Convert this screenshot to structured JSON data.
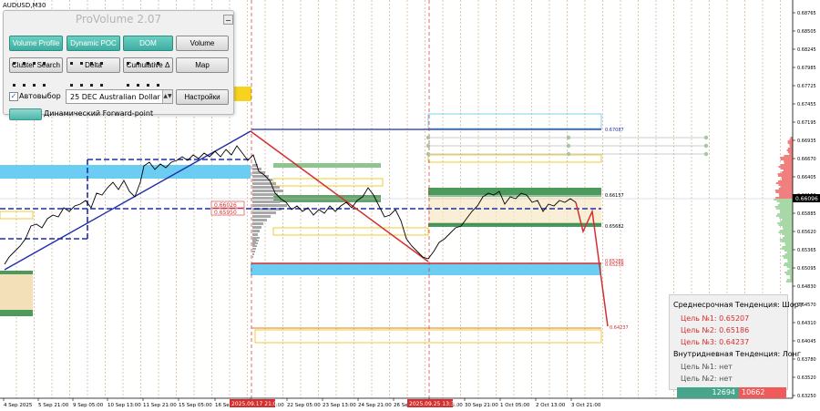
{
  "chart": {
    "symbol": "AUDUSD,M30",
    "current_price": "0.66096",
    "y_ticks": [
      "0.68765",
      "0.68505",
      "0.68245",
      "0.67985",
      "0.67725",
      "0.67455",
      "0.67195",
      "0.66935",
      "0.66670",
      "0.66405",
      "0.66150",
      "0.65885",
      "0.65620",
      "0.65365",
      "0.65095",
      "0.64830",
      "0.64570",
      "0.64310",
      "0.64045",
      "0.63780",
      "0.63520",
      "0.63250"
    ],
    "x_ticks": [
      "4 Sep 2025",
      "5 Sep 21:00",
      "9 Sep 05:00",
      "10 Sep 13:00",
      "11 Sep 21:00",
      "15 Sep 05:00",
      "16 Sep 13:00",
      "17 Sep 21:00",
      "22 Sep 05:00",
      "23 Sep 13:00",
      "24 Sep 21:00",
      "26 Sep 05:00",
      "29 Sep 13:00",
      "30 Sep 21:00",
      "1 Oct 05:00",
      "2 Oct 13:00",
      "3 Oct 21:00"
    ],
    "x_highlight_1": "2025.09.17 21:00",
    "x_highlight_2": "2025.09.25 13:30",
    "levels": {
      "l1": "0.67087",
      "l2": "0.66157",
      "l3": "0.65682",
      "l4": "0.65266",
      "l5": "0.65258",
      "l6": "0.64237",
      "l7": "0.66026",
      "l8": "0.65950"
    },
    "colors": {
      "up": "#2e8b57",
      "down": "#d32f2f",
      "trend": "#1f2ea8",
      "zone_blue": "#5ec8f0",
      "zone_green": "#4e9a5c",
      "zone_yellow": "#f5d31e",
      "zone_beige": "#f1dcb7"
    }
  },
  "panel": {
    "title": "ProVolume 2.07",
    "buttons": {
      "volume_profile": "Volume Profile",
      "dynamic_poc": "Dynamic POC",
      "dom": "DOM",
      "volume": "Volume",
      "cluster_search": "Cluster Search",
      "delta": "Delta",
      "cumulative_delta": "Cumulative Δ",
      "map": "Map",
      "settings": "Настройки"
    },
    "auto_select_label": "Автовыбор",
    "auto_select_checked": "✓",
    "instrument": "25 DEC Australian Dollar",
    "forward_point_label": "Динамический Forward-point"
  },
  "info": {
    "mid_trend": "Среднесрочная Тенденция: Шорт",
    "target1": "Цель №1:  0.65207",
    "target2": "Цель №2:  0.65186",
    "target3": "Цель №3:  0.64237",
    "intraday_trend": "Внутридневная Тенденция: Лонг",
    "intraday_target1": "Цель №1:  нет",
    "intraday_target2": "Цель №2:  нет"
  },
  "volume_bar": {
    "buy": "12694",
    "sell": "10662"
  }
}
